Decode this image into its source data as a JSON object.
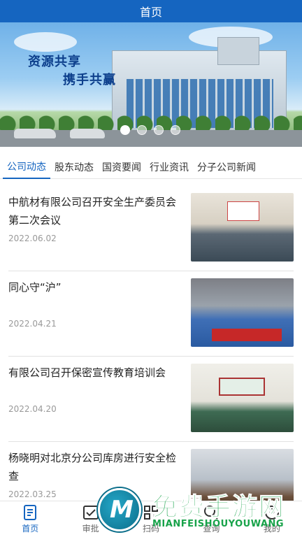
{
  "header": {
    "title": "首页"
  },
  "banner": {
    "slogan_line1": "资源共享",
    "slogan_line2": "携手共赢",
    "dots": 4,
    "active_dot": 1
  },
  "tabs": [
    {
      "label": "公司动态",
      "active": true
    },
    {
      "label": "股东动态",
      "active": false
    },
    {
      "label": "国资要闻",
      "active": false
    },
    {
      "label": "行业资讯",
      "active": false
    },
    {
      "label": "分子公司新闻",
      "active": false
    }
  ],
  "news": [
    {
      "title": "中航材有限公司召开安全生产委员会第二次会议",
      "date": "2022.06.02"
    },
    {
      "title": "同心守“沪”",
      "date": "2022.04.21"
    },
    {
      "title": "有限公司召开保密宣传教育培训会",
      "date": "2022.04.20"
    },
    {
      "title": "杨晓明对北京分公司库房进行安全检查",
      "date": "2022.03.25"
    }
  ],
  "bottom_nav": [
    {
      "label": "首页",
      "icon": "document-icon",
      "active": true
    },
    {
      "label": "审批",
      "icon": "approval-icon",
      "active": false
    },
    {
      "label": "扫码",
      "icon": "qr-scan-icon",
      "active": false
    },
    {
      "label": "查询",
      "icon": "search-icon",
      "active": false
    },
    {
      "label": "我的",
      "icon": "user-icon",
      "active": false
    }
  ],
  "watermark": {
    "logo_letter": "M",
    "text_cn": "免费手游网",
    "text_en": "MIANFEISHOUYOUWANG"
  },
  "colors": {
    "primary": "#1565c0",
    "watermark_green": "#18a34a"
  }
}
